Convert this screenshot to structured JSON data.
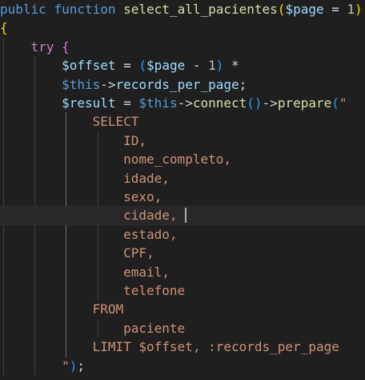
{
  "editor": {
    "language": "php",
    "theme_colors": {
      "background": "#1f1f1f",
      "keyword": "#c586c0",
      "storage": "#569cd6",
      "function": "#dcdcaa",
      "variable": "#9cdcfe",
      "number": "#b5cea8",
      "string": "#ce9178",
      "bracket_level_1": "#ffd700",
      "bracket_level_2": "#da70d6",
      "bracket_level_3": "#179fff"
    },
    "lines": [
      [
        {
          "t": "public",
          "c": "storage"
        },
        {
          "t": " ",
          "c": "op"
        },
        {
          "t": "function",
          "c": "storage"
        },
        {
          "t": " ",
          "c": "op"
        },
        {
          "t": "select_all_pacientes",
          "c": "fn"
        },
        {
          "t": "(",
          "c": "br1"
        },
        {
          "t": "$page",
          "c": "var"
        },
        {
          "t": " = ",
          "c": "op"
        },
        {
          "t": "1",
          "c": "num"
        },
        {
          "t": ")",
          "c": "br1"
        }
      ],
      [
        {
          "t": "{",
          "c": "br1"
        }
      ],
      [
        {
          "t": "    ",
          "c": "op"
        },
        {
          "t": "try",
          "c": "kw"
        },
        {
          "t": " ",
          "c": "op"
        },
        {
          "t": "{",
          "c": "br2"
        }
      ],
      [
        {
          "t": "        ",
          "c": "op"
        },
        {
          "t": "$offset",
          "c": "var"
        },
        {
          "t": " = ",
          "c": "op"
        },
        {
          "t": "(",
          "c": "br3"
        },
        {
          "t": "$page",
          "c": "var"
        },
        {
          "t": " - ",
          "c": "op"
        },
        {
          "t": "1",
          "c": "num"
        },
        {
          "t": ")",
          "c": "br3"
        },
        {
          "t": " *",
          "c": "op"
        }
      ],
      [
        {
          "t": "        ",
          "c": "op"
        },
        {
          "t": "$this",
          "c": "storage"
        },
        {
          "t": "->",
          "c": "op"
        },
        {
          "t": "records_per_page",
          "c": "var"
        },
        {
          "t": ";",
          "c": "op"
        }
      ],
      [
        {
          "t": "        ",
          "c": "op"
        },
        {
          "t": "$result",
          "c": "var"
        },
        {
          "t": " = ",
          "c": "op"
        },
        {
          "t": "$this",
          "c": "storage"
        },
        {
          "t": "->",
          "c": "op"
        },
        {
          "t": "connect",
          "c": "fn"
        },
        {
          "t": "()",
          "c": "br3"
        },
        {
          "t": "->",
          "c": "op"
        },
        {
          "t": "prepare",
          "c": "fn"
        },
        {
          "t": "(",
          "c": "br3"
        },
        {
          "t": "\"",
          "c": "str"
        }
      ],
      [
        {
          "t": "            ",
          "c": "op"
        },
        {
          "t": "SELECT",
          "c": "str"
        }
      ],
      [
        {
          "t": "                ",
          "c": "op"
        },
        {
          "t": "ID,",
          "c": "str"
        }
      ],
      [
        {
          "t": "                ",
          "c": "op"
        },
        {
          "t": "nome_completo,",
          "c": "str"
        }
      ],
      [
        {
          "t": "                ",
          "c": "op"
        },
        {
          "t": "idade,",
          "c": "str"
        }
      ],
      [
        {
          "t": "                ",
          "c": "op"
        },
        {
          "t": "sexo,",
          "c": "str"
        }
      ],
      [
        {
          "t": "                ",
          "c": "op"
        },
        {
          "t": "cidade,",
          "c": "str"
        }
      ],
      [
        {
          "t": "                ",
          "c": "op"
        },
        {
          "t": "estado,",
          "c": "str"
        }
      ],
      [
        {
          "t": "                ",
          "c": "op"
        },
        {
          "t": "CPF,",
          "c": "str"
        }
      ],
      [
        {
          "t": "                ",
          "c": "op"
        },
        {
          "t": "email,",
          "c": "str"
        }
      ],
      [
        {
          "t": "                ",
          "c": "op"
        },
        {
          "t": "telefone",
          "c": "str"
        }
      ],
      [
        {
          "t": "            ",
          "c": "op"
        },
        {
          "t": "FROM",
          "c": "str"
        }
      ],
      [
        {
          "t": "                ",
          "c": "op"
        },
        {
          "t": "paciente",
          "c": "str"
        }
      ],
      [
        {
          "t": "            ",
          "c": "op"
        },
        {
          "t": "LIMIT $offset, :records_per_page",
          "c": "str"
        }
      ],
      [
        {
          "t": "        ",
          "c": "op"
        },
        {
          "t": "\"",
          "c": "str"
        },
        {
          "t": ")",
          "c": "br3"
        },
        {
          "t": ";",
          "c": "op"
        }
      ]
    ],
    "current_line": 11,
    "cursor_column": 24
  }
}
